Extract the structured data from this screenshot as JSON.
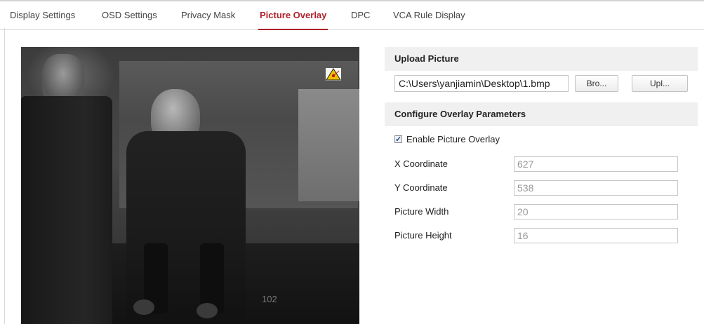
{
  "tabs": [
    {
      "label": "Display Settings",
      "active": false
    },
    {
      "label": "OSD Settings",
      "active": false
    },
    {
      "label": "Privacy Mask",
      "active": false
    },
    {
      "label": "Picture Overlay",
      "active": true
    },
    {
      "label": "DPC",
      "active": false
    },
    {
      "label": "VCA Rule Display",
      "active": false
    }
  ],
  "video": {
    "stamp_text": "102",
    "overlay_icon": "warning-triangle-icon"
  },
  "upload": {
    "title": "Upload Picture",
    "path_value": "C:\\Users\\yanjiamin\\Desktop\\1.bmp",
    "browse_label": "Bro...",
    "upload_label": "Upl..."
  },
  "overlay_params": {
    "title": "Configure Overlay Parameters",
    "enable_label": "Enable Picture Overlay",
    "enable_checked": true,
    "fields": [
      {
        "label": "X Coordinate",
        "value": "627"
      },
      {
        "label": "Y Coordinate",
        "value": "538"
      },
      {
        "label": "Picture Width",
        "value": "20"
      },
      {
        "label": "Picture Height",
        "value": "16"
      }
    ]
  },
  "colors": {
    "accent": "#b0202a",
    "section_bg": "#f0f0f0"
  }
}
